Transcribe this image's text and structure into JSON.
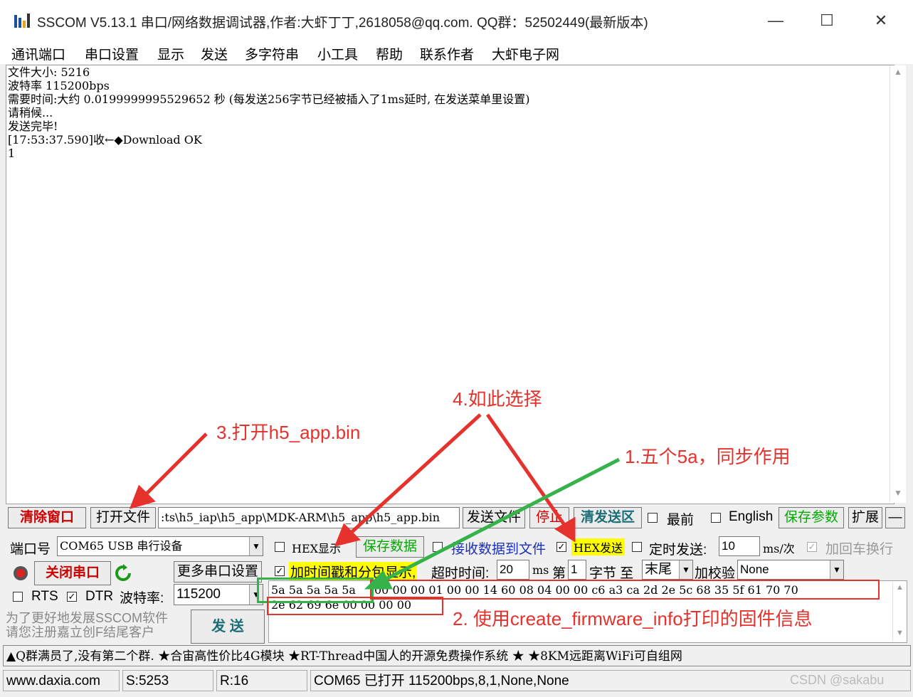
{
  "window": {
    "title": "SSCOM V5.13.1 串口/网络数据调试器,作者:大虾丁丁,2618058@qq.com. QQ群：52502449(最新版本)",
    "minimize": "—",
    "maximize": "☐",
    "close": "✕"
  },
  "menu": [
    "通讯端口",
    "串口设置",
    "显示",
    "发送",
    "多字符串",
    "小工具",
    "帮助",
    "联系作者",
    "大虾电子网"
  ],
  "receive": {
    "lines": [
      "文件大小: 5216",
      "波特率 115200bps",
      "需要时间:大约 0.0199999995529652 秒 (每发送256字节已经被插入了1ms延时, 在发送菜单里设置)",
      "请稍候...",
      "发送完毕!",
      "[17:53:37.590]收←◆Download OK",
      "1"
    ]
  },
  "toolbar": {
    "clear_window": "清除窗口",
    "open_file": "打开文件",
    "file_path": ":ts\\h5_iap\\h5_app\\MDK-ARM\\h5_app\\h5_app.bin",
    "send_file": "发送文件",
    "stop": "停止",
    "clear_send": "清发送区",
    "topmost": "最前",
    "english": "English",
    "save_params": "保存参数",
    "expand": "扩展",
    "collapse": "—"
  },
  "port": {
    "label": "端口号",
    "value": "COM65 USB 串行设备",
    "close_port": "关闭串口",
    "more_settings": "更多串口设置",
    "rts": "RTS",
    "dtr": "DTR",
    "baud_label": "波特率:",
    "baud_value": "115200"
  },
  "options": {
    "hex_display": "HEX显示",
    "save_data": "保存数据",
    "recv_to_file": "接收数据到文件",
    "hex_send": "HEX发送",
    "timed_send": "定时发送:",
    "timed_interval": "10",
    "timed_unit": "ms/次",
    "append_crlf": "加回车换行",
    "timestamp": "加时间戳和分包显示,",
    "timeout_label": "超时时间:",
    "timeout_value": "20",
    "timeout_unit": "ms",
    "from_label": "第",
    "from_value": "1",
    "bytes_to": "字节 至",
    "end_value": "末尾",
    "checksum_label": "加校验",
    "checksum_value": "None"
  },
  "send_data": {
    "sync": "5a 5a 5a 5a 5a",
    "info_line1": "00 00 00 01 00 00 14 60 08 04 00 00 c6 a3 ca 2d 2e 5c 68 35 5f 61 70 70",
    "info_line2": "2e 62 69 6e 00 00 00 00",
    "send_button": "发 送"
  },
  "promo": {
    "line1": "为了更好地发展SSCOM软件",
    "line2": "请您注册嘉立创F结尾客户"
  },
  "ad_bar": "▲Q群满员了,没有第二个群. ★合宙高性价比4G模块 ★RT-Thread中国人的开源免费操作系统 ★ ★8KM远距离WiFi可自组网",
  "status": {
    "site": "www.daxia.com",
    "sent": "S:5253",
    "received": "R:16",
    "port_state": "COM65 已打开  115200bps,8,1,None,None",
    "watermark": "CSDN @sakabu"
  },
  "annotations": {
    "a1": "1.五个5a，同步作用",
    "a2": "2. 使用create_firmware_info打印的固件信息",
    "a3": "3.打开h5_app.bin",
    "a4": "4.如此选择"
  },
  "colors": {
    "annotation_red": "#e5322d",
    "annotation_green": "#35b24a",
    "highlight_yellow": "#ffff00"
  }
}
